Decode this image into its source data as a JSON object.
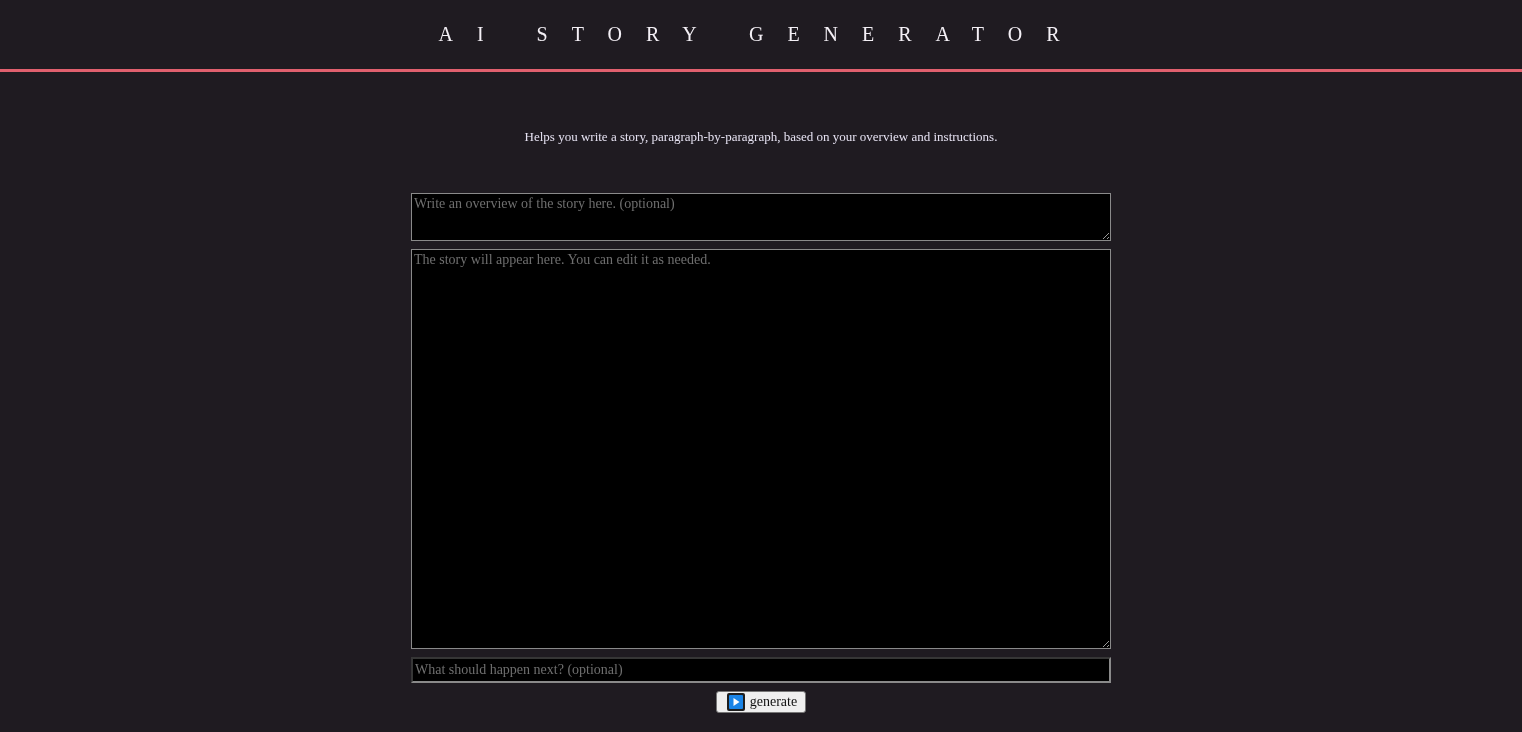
{
  "header": {
    "title": "AI STORY GENERATOR"
  },
  "description": "Helps you write a story, paragraph-by-paragraph, based on your overview and instructions.",
  "overview_field": {
    "placeholder": "Write an overview of the story here. (optional)"
  },
  "story_field": {
    "placeholder": "The story will appear here. You can edit it as needed."
  },
  "instruction_field": {
    "placeholder": "What should happen next? (optional)"
  },
  "generate_button": {
    "label": "generate"
  }
}
